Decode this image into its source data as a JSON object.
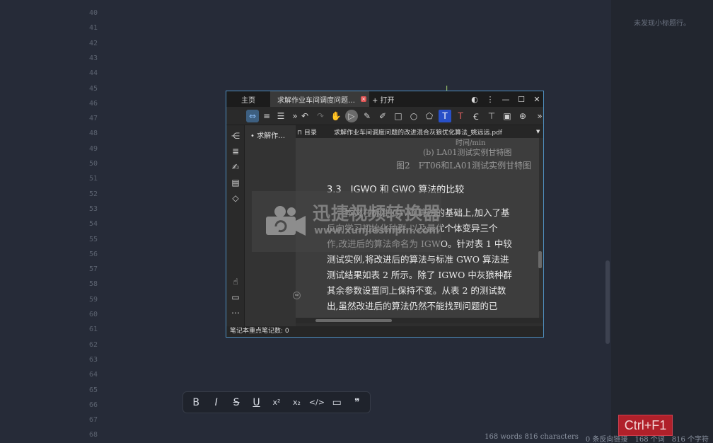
{
  "editor": {
    "line_numbers": [
      "40",
      "41",
      "42",
      "43",
      "44",
      "45",
      "46",
      "47",
      "48",
      "49",
      "50",
      "51",
      "52",
      "53",
      "54",
      "55",
      "56",
      "57",
      "58",
      "59",
      "60",
      "61",
      "62",
      "63",
      "64",
      "65",
      "66",
      "67",
      "68"
    ],
    "format_toolbar": [
      {
        "icon": "bold-icon",
        "glyph": "B"
      },
      {
        "icon": "italic-icon",
        "glyph": "I"
      },
      {
        "icon": "strikethrough-icon",
        "glyph": "S"
      },
      {
        "icon": "underline-icon",
        "glyph": "U"
      },
      {
        "icon": "superscript-icon",
        "glyph": "x²"
      },
      {
        "icon": "subscript-icon",
        "glyph": "x₂"
      },
      {
        "icon": "code-icon",
        "glyph": "</>"
      },
      {
        "icon": "window-icon",
        "glyph": "▭"
      },
      {
        "icon": "quote-icon",
        "glyph": "❞"
      }
    ]
  },
  "outline_panel": {
    "empty_text": "未发现小标题行。"
  },
  "status_bar": {
    "words_en": "168 words 816 characters",
    "backlinks": "0 条反向链接",
    "words_zh": "168 个词",
    "chars_zh": "816 个字符"
  },
  "shortcut_badge": "Ctrl+F1",
  "pdf_viewer": {
    "tabs": {
      "home": "主页",
      "doc": "求解作业车间调度问题…",
      "open": "+ 打开"
    },
    "toc_label": "目录",
    "file_name": "求解作业车间调度问题的改进混合灰狼优化算法_姚远远.pdf",
    "toc_items": [
      "求解作…"
    ],
    "page": {
      "caption_time": "时间/min",
      "caption_b": "(b) LA01测试实例甘特图",
      "caption_fig": "图2　FT06和LA01测试实例甘特图",
      "section_heading": "3.3　IGWO 和 GWO 算法的比较",
      "lines": [
        "本文在标准 GWO 算法的基础上,加入了基",
        "反向学习初始化种群,以及最优个体变异三个",
        "作,改进后的算法命名为 IGWO。针对表 1 中较",
        "测试实例,将改进后的算法与标准 GWO 算法进",
        "测试结果如表 2 所示。除了 IGWO 中灰狼种群",
        "其余参数设置同上保持不变。从表 2 的测试数",
        "出,虽然改进后的算法仍然不能找到问题的已"
      ]
    },
    "notes_status": "笔记本重点笔记数: 0"
  },
  "watermark": {
    "title": "迅捷视频转换器",
    "url": "www.xunjieshipin.com"
  },
  "colors": {
    "editor_bg": "#262b38",
    "badge_red": "#b0202a",
    "window_border": "#4f8fbf"
  }
}
